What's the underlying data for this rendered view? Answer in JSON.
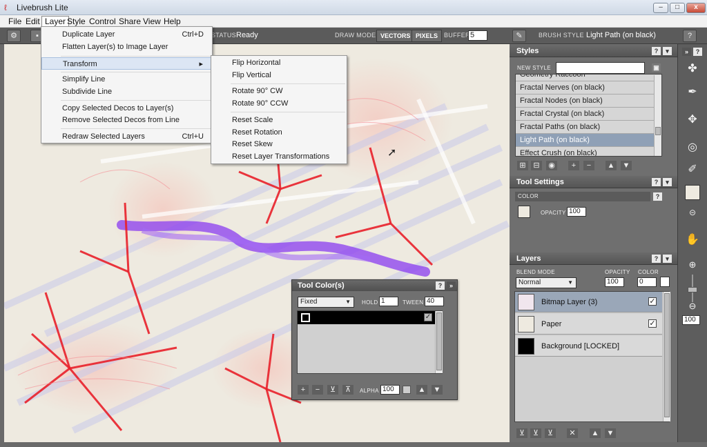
{
  "window": {
    "title": "Livebrush Lite",
    "controls": [
      "–",
      "□",
      "x"
    ]
  },
  "menubar": [
    "File",
    "Edit",
    "Layer",
    "Style",
    "Control",
    "Share",
    "View",
    "Help"
  ],
  "toolbar": {
    "status_label": "STATUS",
    "status_value": "Ready",
    "draw_mode_label": "DRAW MODE",
    "vectors": "VECTORS",
    "pixels": "PIXELS",
    "buffer_label": "BUFFER",
    "buffer_value": "5",
    "brush_style_label": "BRUSH STYLE",
    "brush_style_value": "Light Path (on black)",
    "help": "?"
  },
  "layer_menu": [
    {
      "label": "Duplicate Layer",
      "shortcut": "Ctrl+D"
    },
    {
      "label": "Flatten Layer(s) to Image Layer",
      "shortcut": ""
    },
    {
      "label": "Transform",
      "shortcut": "▸"
    },
    {
      "label": "Simplify Line",
      "shortcut": ""
    },
    {
      "label": "Subdivide Line",
      "shortcut": ""
    },
    {
      "label": "Copy Selected Decos to Layer(s)",
      "shortcut": ""
    },
    {
      "label": "Remove Selected Decos from Line",
      "shortcut": ""
    },
    {
      "label": "Redraw Selected Layers",
      "shortcut": "Ctrl+U"
    }
  ],
  "transform_menu": [
    "Flip Horizontal",
    "Flip Vertical",
    "Rotate 90° CW",
    "Rotate 90° CCW",
    "Reset Scale",
    "Reset Rotation",
    "Reset Skew",
    "Reset Layer Transformations"
  ],
  "styles_panel": {
    "title": "Styles",
    "new_style_label": "NEW STYLE",
    "new_style_value": "",
    "items": [
      "Geometry Raccoon",
      "Fractal Nerves (on black)",
      "Fractal Nodes (on black)",
      "Fractal Crystal (on black)",
      "Fractal Paths (on black)",
      "Light Path (on black)",
      "Effect Crush (on black)"
    ],
    "selected_index": 5
  },
  "tool_settings": {
    "title": "Tool Settings",
    "color_label": "COLOR",
    "opacity_label": "OPACITY",
    "opacity_value": "100"
  },
  "layers_panel": {
    "title": "Layers",
    "blend_mode_label": "BLEND MODE",
    "blend_mode_value": "Normal",
    "opacity_label": "OPACITY",
    "opacity_value": "100",
    "color_label": "COLOR",
    "color_value": "0",
    "layers": [
      {
        "name": "Bitmap Layer (3)",
        "checked": true,
        "selected": true
      },
      {
        "name": "Paper",
        "checked": true,
        "selected": false
      },
      {
        "name": "Background [LOCKED]",
        "checked": false,
        "selected": false
      }
    ]
  },
  "tool_color_panel": {
    "title": "Tool Color(s)",
    "mode_value": "Fixed",
    "hold_label": "HOLD",
    "hold_value": "1",
    "tween_label": "TWEEN",
    "tween_value": "40",
    "alpha_label": "ALPHA",
    "alpha_value": "100"
  },
  "zoom_value": "100",
  "colors": {
    "accent_selection": "#8fa0b6",
    "canvas_bg": "#eeeae0",
    "stroke_red": "#e8202a",
    "stroke_purple": "#8a3cf0"
  }
}
